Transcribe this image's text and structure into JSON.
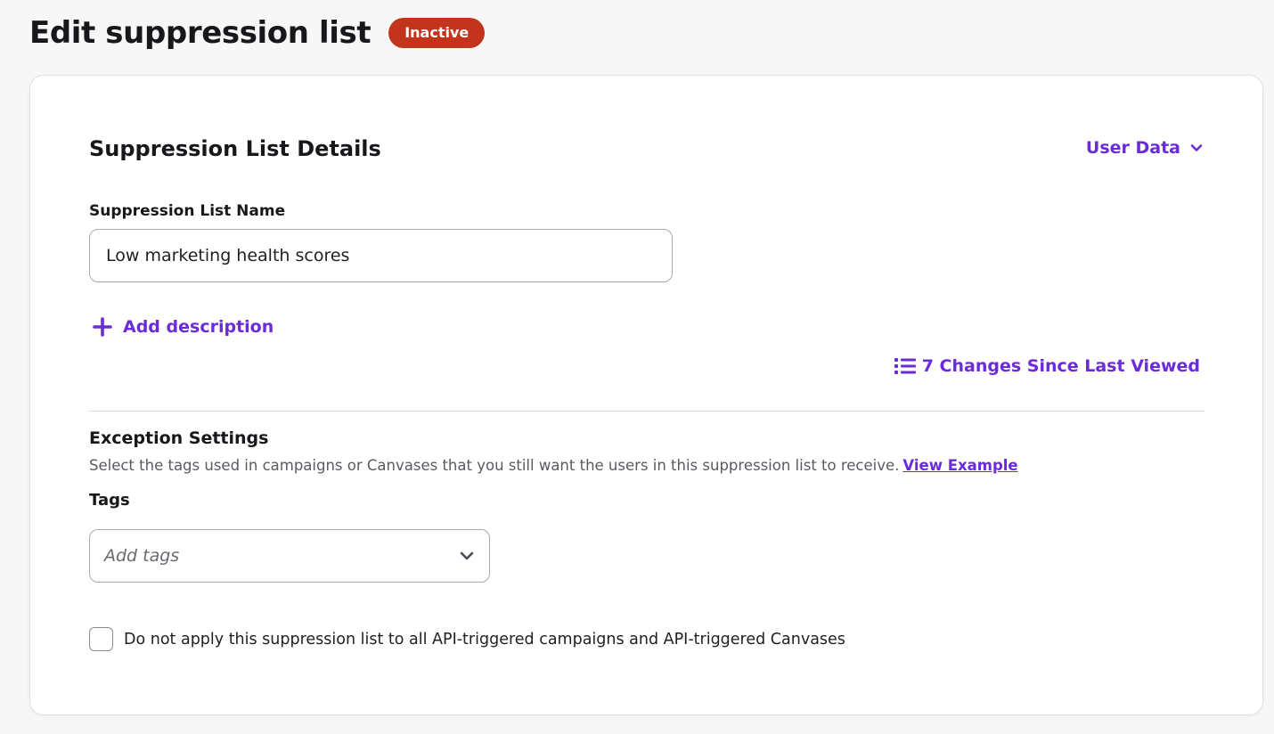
{
  "header": {
    "title": "Edit suppression list",
    "status": "Inactive"
  },
  "details": {
    "section_title": "Suppression List Details",
    "user_data_label": "User Data",
    "name_label": "Suppression List Name",
    "name_value": "Low marketing health scores",
    "add_description_label": "Add description",
    "changes_label": "7 Changes Since Last Viewed"
  },
  "exceptions": {
    "title": "Exception Settings",
    "description": "Select the tags used in campaigns or Canvases that you still want the users in this suppression list to receive.",
    "view_example_label": "View Example",
    "tags_label": "Tags",
    "tags_placeholder": "Add tags",
    "api_checkbox_label": "Do not apply this suppression list to all API-triggered campaigns and API-triggered Canvases",
    "api_checkbox_checked": false
  },
  "colors": {
    "accent": "#6b2bd9",
    "status_inactive": "#c2341c"
  },
  "icons": {
    "user_data": "chevron-down-icon",
    "add_description": "plus-icon",
    "changes": "list-icon",
    "tags": "chevron-down-icon"
  }
}
